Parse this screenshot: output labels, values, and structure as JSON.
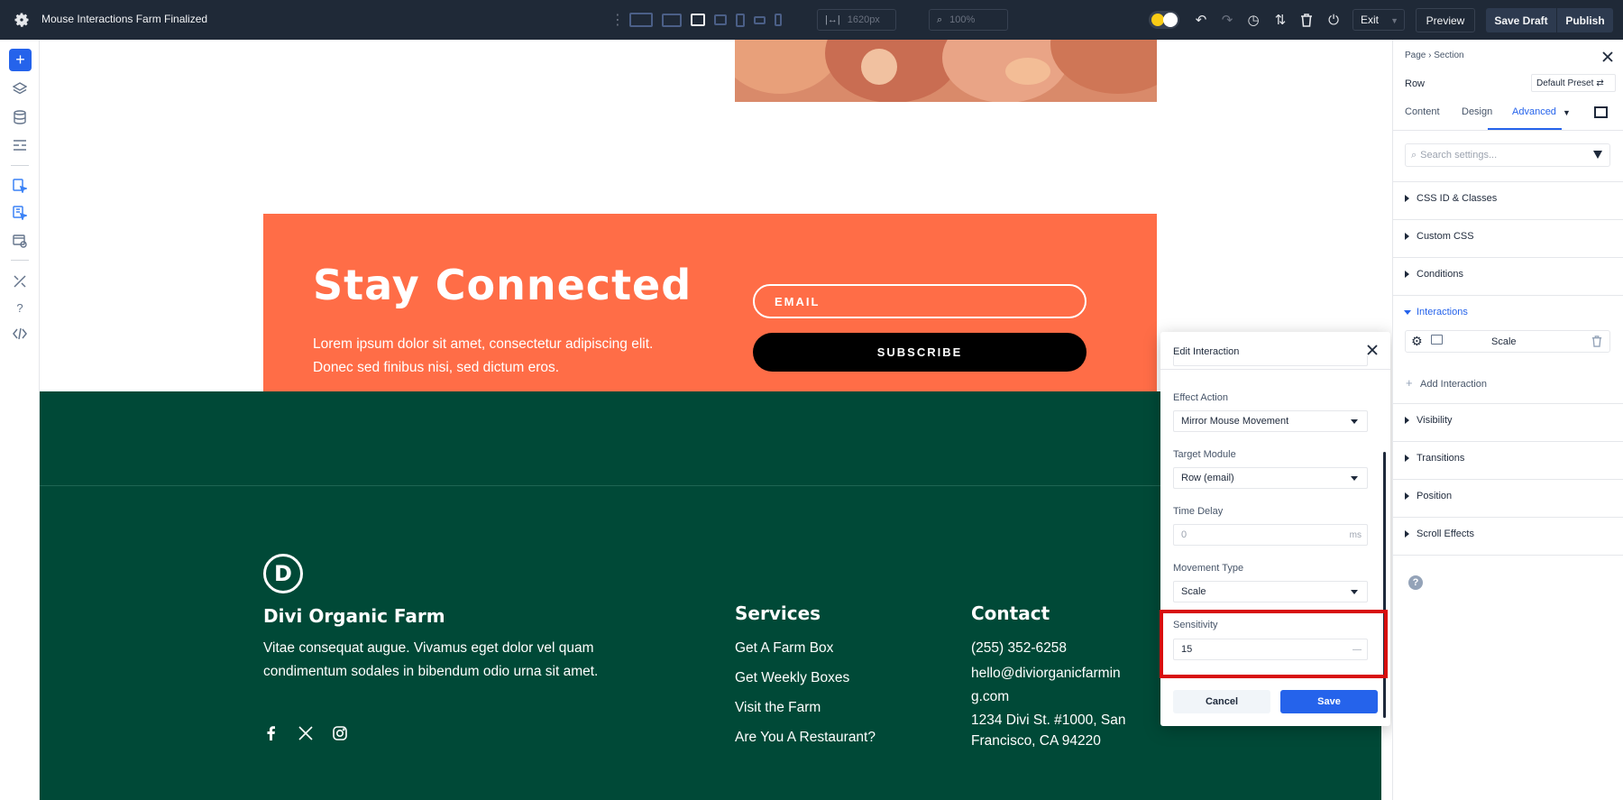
{
  "topbar": {
    "title": "Mouse Interactions  Farm Finalized",
    "width_value": "1620px",
    "zoom_value": "100%",
    "exit_label": "Exit",
    "preview_label": "Preview",
    "save_draft_label": "Save Draft",
    "publish_label": "Publish"
  },
  "canvas": {
    "cta": {
      "heading": "Stay Connected",
      "body": "Lorem ipsum dolor sit amet, consectetur adipiscing elit. Donec sed finibus nisi, sed dictum eros.",
      "email_placeholder": "EMAIL",
      "subscribe_label": "SUBSCRIBE"
    },
    "footer": {
      "logo_letter": "D",
      "brand_title": "Divi Organic Farm",
      "brand_text": "Vitae consequat augue. Vivamus eget dolor vel quam condimentum sodales in bibendum odio urna sit amet.",
      "services_title": "Services",
      "services": [
        "Get A Farm Box",
        "Get Weekly Boxes",
        "Visit the Farm",
        "Are You A Restaurant?"
      ],
      "contact_title": "Contact",
      "phone": "(255) 352-6258",
      "email": "hello@diviorganicfarming.com",
      "address": "1234 Divi St. #1000, San Francisco, CA 94220"
    }
  },
  "modal": {
    "title": "Edit Interaction",
    "effect_action_label": "Effect Action",
    "effect_action_value": "Mirror Mouse Movement",
    "target_module_label": "Target Module",
    "target_module_value": "Row (email)",
    "time_delay_label": "Time Delay",
    "time_delay_value": "0",
    "time_delay_unit": "ms",
    "movement_type_label": "Movement Type",
    "movement_type_value": "Scale",
    "sensitivity_label": "Sensitivity",
    "sensitivity_value": "15",
    "sensitivity_unit": "—",
    "cancel_label": "Cancel",
    "save_label": "Save"
  },
  "panel": {
    "breadcrumb_page": "Page",
    "breadcrumb_section": "Section",
    "element_label": "Row",
    "preset_label": "Default Preset",
    "tabs": [
      "Content",
      "Design",
      "Advanced"
    ],
    "active_tab": "Advanced",
    "search_placeholder": "Search settings...",
    "sections": [
      "CSS ID & Classes",
      "Custom CSS",
      "Conditions",
      "Interactions",
      "Visibility",
      "Transitions",
      "Position",
      "Scroll Effects"
    ],
    "interaction_item": "Scale",
    "add_interaction_label": "Add Interaction",
    "help_glyph": "?"
  },
  "colors": {
    "topbar_bg": "#1f2937",
    "accent": "#2563eb",
    "cta_bg": "#ff6d47",
    "footer_bg": "#004937",
    "highlight": "#d80f0f"
  }
}
